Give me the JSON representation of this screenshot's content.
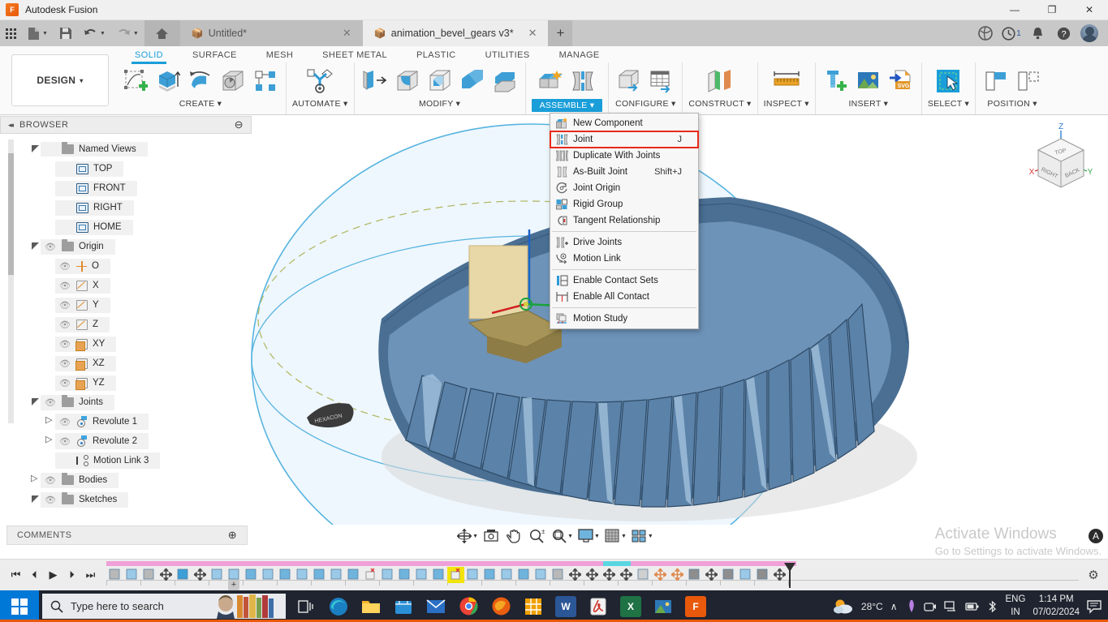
{
  "window": {
    "app_title": "Autodesk Fusion",
    "app_logo_text": "F",
    "minimize": "—",
    "maximize": "❐",
    "close": "✕"
  },
  "quick_access": {
    "grid_icon": "apps-grid-icon",
    "new_label": "new-file-icon",
    "save_label": "save-icon",
    "undo_label": "undo-icon",
    "redo_label": "redo-icon",
    "home_label": "home-icon",
    "tabs": [
      {
        "title": "Untitled*",
        "active": false,
        "close": "✕"
      },
      {
        "title": "animation_bevel_gears v3*",
        "active": true,
        "close": "✕"
      }
    ],
    "add_tab": "+",
    "right_icons": [
      {
        "name": "extensions-icon",
        "badge": ""
      },
      {
        "name": "job-status-icon",
        "badge": "1"
      },
      {
        "name": "notifications-bell-icon",
        "badge": ""
      },
      {
        "name": "help-icon",
        "badge": ""
      },
      {
        "name": "account-avatar",
        "badge": ""
      }
    ]
  },
  "ribbon": {
    "workspace": "DESIGN",
    "workspace_caret": "▾",
    "tabs": [
      {
        "label": "SOLID",
        "active": true
      },
      {
        "label": "SURFACE",
        "active": false
      },
      {
        "label": "MESH",
        "active": false
      },
      {
        "label": "SHEET METAL",
        "active": false
      },
      {
        "label": "PLASTIC",
        "active": false
      },
      {
        "label": "UTILITIES",
        "active": false
      },
      {
        "label": "MANAGE",
        "active": false
      }
    ],
    "panels": [
      {
        "label": "CREATE",
        "caret": "▾",
        "highlight": false
      },
      {
        "label": "AUTOMATE",
        "caret": "▾",
        "highlight": false
      },
      {
        "label": "MODIFY",
        "caret": "▾",
        "highlight": false
      },
      {
        "label": "ASSEMBLE",
        "caret": "▾",
        "highlight": true
      },
      {
        "label": "CONFIGURE",
        "caret": "▾",
        "highlight": false
      },
      {
        "label": "CONSTRUCT",
        "caret": "▾",
        "highlight": false
      },
      {
        "label": "INSPECT",
        "caret": "▾",
        "highlight": false
      },
      {
        "label": "INSERT",
        "caret": "▾",
        "highlight": false
      },
      {
        "label": "SELECT",
        "caret": "▾",
        "highlight": false
      },
      {
        "label": "POSITION",
        "caret": "▾",
        "highlight": false
      }
    ]
  },
  "assemble_menu": {
    "items": [
      {
        "label": "New Component",
        "shortcut": "",
        "icon": "new-component-icon",
        "highlighted": false,
        "separator_after": false
      },
      {
        "label": "Joint",
        "shortcut": "J",
        "icon": "joint-icon",
        "highlighted": true,
        "separator_after": false
      },
      {
        "label": "Duplicate With Joints",
        "shortcut": "",
        "icon": "duplicate-with-joints-icon",
        "highlighted": false,
        "separator_after": false
      },
      {
        "label": "As-Built Joint",
        "shortcut": "Shift+J",
        "icon": "as-built-joint-icon",
        "highlighted": false,
        "separator_after": false
      },
      {
        "label": "Joint Origin",
        "shortcut": "",
        "icon": "joint-origin-icon",
        "highlighted": false,
        "separator_after": false
      },
      {
        "label": "Rigid Group",
        "shortcut": "",
        "icon": "rigid-group-icon",
        "highlighted": false,
        "separator_after": false
      },
      {
        "label": "Tangent Relationship",
        "shortcut": "",
        "icon": "tangent-relationship-icon",
        "highlighted": false,
        "separator_after": true
      },
      {
        "label": "Drive Joints",
        "shortcut": "",
        "icon": "drive-joints-icon",
        "highlighted": false,
        "separator_after": false
      },
      {
        "label": "Motion Link",
        "shortcut": "",
        "icon": "motion-link-icon",
        "highlighted": false,
        "separator_after": true
      },
      {
        "label": "Enable Contact Sets",
        "shortcut": "",
        "icon": "enable-contact-sets-icon",
        "highlighted": false,
        "separator_after": false
      },
      {
        "label": "Enable All Contact",
        "shortcut": "",
        "icon": "enable-all-contact-icon",
        "highlighted": false,
        "separator_after": true
      },
      {
        "label": "Motion Study",
        "shortcut": "",
        "icon": "motion-study-icon",
        "highlighted": false,
        "separator_after": false
      }
    ]
  },
  "browser": {
    "title": "BROWSER",
    "collapse_icon": "◂◂",
    "minus_icon": "⊖",
    "nodes": [
      {
        "label": "Named Views",
        "indent": 1,
        "toggle": "open",
        "eye": false,
        "icon": "folder-icon"
      },
      {
        "label": "TOP",
        "indent": 2,
        "toggle": "none",
        "eye": false,
        "icon": "view-icon"
      },
      {
        "label": "FRONT",
        "indent": 2,
        "toggle": "none",
        "eye": false,
        "icon": "view-icon"
      },
      {
        "label": "RIGHT",
        "indent": 2,
        "toggle": "none",
        "eye": false,
        "icon": "view-icon"
      },
      {
        "label": "HOME",
        "indent": 2,
        "toggle": "none",
        "eye": false,
        "icon": "view-icon"
      },
      {
        "label": "Origin",
        "indent": 1,
        "toggle": "open",
        "eye": true,
        "icon": "folder-icon"
      },
      {
        "label": "O",
        "indent": 2,
        "toggle": "none",
        "eye": true,
        "icon": "origin-point-icon"
      },
      {
        "label": "X",
        "indent": 2,
        "toggle": "none",
        "eye": true,
        "icon": "axis-icon"
      },
      {
        "label": "Y",
        "indent": 2,
        "toggle": "none",
        "eye": true,
        "icon": "axis-icon"
      },
      {
        "label": "Z",
        "indent": 2,
        "toggle": "none",
        "eye": true,
        "icon": "axis-icon"
      },
      {
        "label": "XY",
        "indent": 2,
        "toggle": "none",
        "eye": true,
        "icon": "plane-icon"
      },
      {
        "label": "XZ",
        "indent": 2,
        "toggle": "none",
        "eye": true,
        "icon": "plane-icon"
      },
      {
        "label": "YZ",
        "indent": 2,
        "toggle": "none",
        "eye": true,
        "icon": "plane-icon"
      },
      {
        "label": "Joints",
        "indent": 1,
        "toggle": "open",
        "eye": true,
        "icon": "folder-icon"
      },
      {
        "label": "Revolute 1",
        "indent": 2,
        "toggle": "closed",
        "eye": true,
        "icon": "revolute-joint-icon"
      },
      {
        "label": "Revolute 2",
        "indent": 2,
        "toggle": "closed",
        "eye": true,
        "icon": "revolute-joint-icon"
      },
      {
        "label": "Motion Link 3",
        "indent": 2,
        "toggle": "none",
        "eye": false,
        "icon": "motion-link-icon"
      },
      {
        "label": "Bodies",
        "indent": 1,
        "toggle": "closed",
        "eye": true,
        "icon": "folder-icon"
      },
      {
        "label": "Sketches",
        "indent": 1,
        "toggle": "open",
        "eye": true,
        "icon": "folder-icon"
      }
    ]
  },
  "comments": {
    "title": "COMMENTS",
    "add_icon": "⊕"
  },
  "nav_bar": {
    "tools": [
      {
        "name": "orbit-icon",
        "caret": true
      },
      {
        "name": "look-at-icon",
        "caret": false
      },
      {
        "name": "pan-icon",
        "caret": false
      },
      {
        "name": "zoom-icon",
        "caret": false
      },
      {
        "name": "zoom-window-icon",
        "caret": true
      },
      {
        "name": "display-settings-icon",
        "caret": true
      },
      {
        "name": "grid-snap-icon",
        "caret": true
      },
      {
        "name": "viewports-icon",
        "caret": true
      }
    ]
  },
  "watermark": {
    "line1": "Activate Windows",
    "line2": "Go to Settings to activate Windows."
  },
  "timeline": {
    "playback": [
      "⏮",
      "⏴",
      "▶",
      "⏵",
      "⏭"
    ],
    "selected_index": 20,
    "settings_icon": "⚙",
    "add_marker": "+",
    "features": [
      "sketch-group-icon",
      "sketch-icon",
      "duplicate-icon",
      "move-icon",
      "rectangle-icon",
      "move-icon",
      "sketch-icon",
      "sketch-icon",
      "revolve-icon",
      "sketch-icon",
      "loft-icon",
      "sketch-icon",
      "extrude-icon",
      "sketch-icon",
      "extrude-icon",
      "delete-body-icon",
      "sketch-icon",
      "extrude-icon",
      "sketch-icon",
      "extrude-icon",
      "delete-body-icon",
      "sketch-icon",
      "extrude-icon",
      "sketch-icon",
      "extrude-icon",
      "sketch-icon",
      "duplicate-icon",
      "move-icon",
      "move-icon",
      "move-icon",
      "move-icon",
      "group-icon",
      "pin-icon",
      "pin-icon",
      "joint-icon",
      "move-icon",
      "joint-icon",
      "rigid-group-icon",
      "motion-link-icon",
      "move-icon"
    ]
  },
  "taskbar": {
    "start_icon": "windows-logo-icon",
    "search_placeholder": "Type here to search",
    "search_icon": "search-icon",
    "apps": [
      "task-view-icon",
      "edge-icon",
      "file-explorer-icon",
      "store-icon",
      "mail-icon",
      "chrome-icon",
      "firefox-icon",
      "snip-icon",
      "word-icon",
      "acrobat-icon",
      "excel-icon",
      "photos-icon",
      "fusion-icon"
    ],
    "tray": {
      "weather_temp": "28°C",
      "weather_icon": "partly-cloudy-icon",
      "chevron": "∧",
      "icons": [
        "pen-icon",
        "camera-icon",
        "network-icon",
        "battery-icon",
        "bluetooth-icon"
      ],
      "language_line1": "ENG",
      "language_line2": "IN",
      "time": "1:14 PM",
      "date": "07/02/2024",
      "action_center": "notification-icon"
    }
  }
}
